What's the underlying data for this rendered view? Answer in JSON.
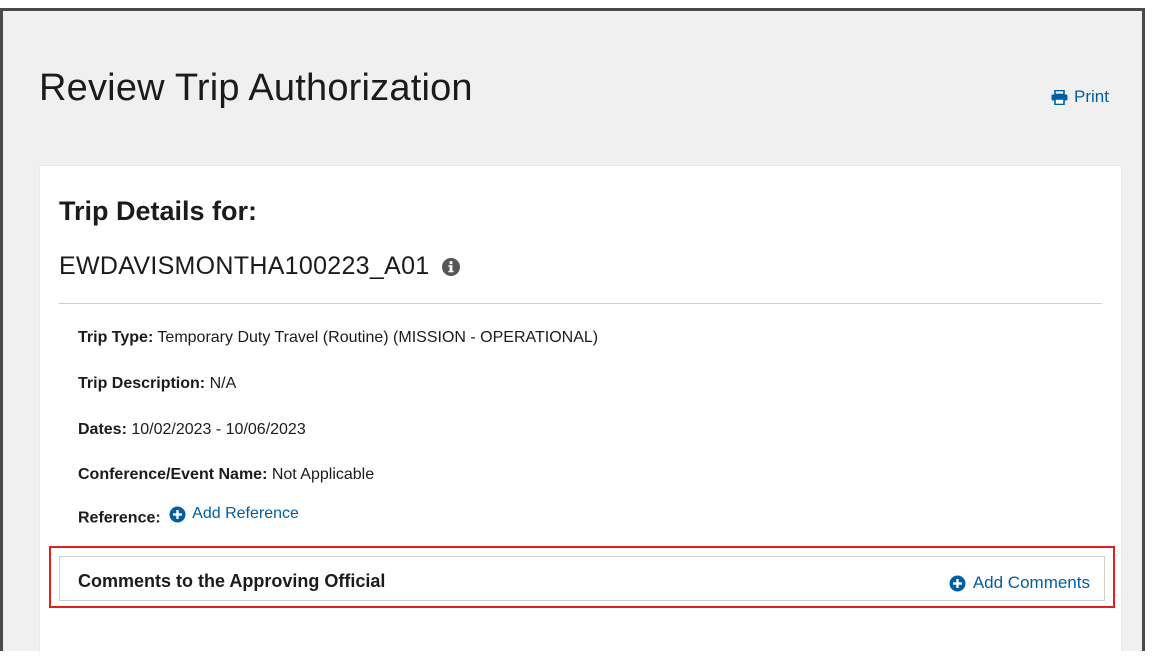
{
  "page": {
    "title": "Review Trip Authorization",
    "print_label": "Print"
  },
  "trip": {
    "heading": "Trip Details for:",
    "id": "EWDAVISMONTHA100223_A01",
    "fields": [
      {
        "label": "Trip Type:",
        "value": " Temporary Duty Travel (Routine) (MISSION - OPERATIONAL)"
      },
      {
        "label": "Trip Description:",
        "value": " N/A"
      },
      {
        "label": "Dates:",
        "value": " 10/02/2023 - 10/06/2023"
      },
      {
        "label": "Conference/Event Name:",
        "value": " Not Applicable"
      }
    ],
    "reference": {
      "label": "Reference:",
      "action_label": "Add Reference"
    }
  },
  "comments": {
    "title": "Comments to the Approving Official",
    "action_label": "Add Comments"
  },
  "icons": {
    "print": "printer-icon",
    "info": "info-circle-icon",
    "add": "plus-circle-icon"
  },
  "colors": {
    "link": "#005ea2",
    "highlight_border": "#e41d1d",
    "background": "#f0f0f0"
  }
}
